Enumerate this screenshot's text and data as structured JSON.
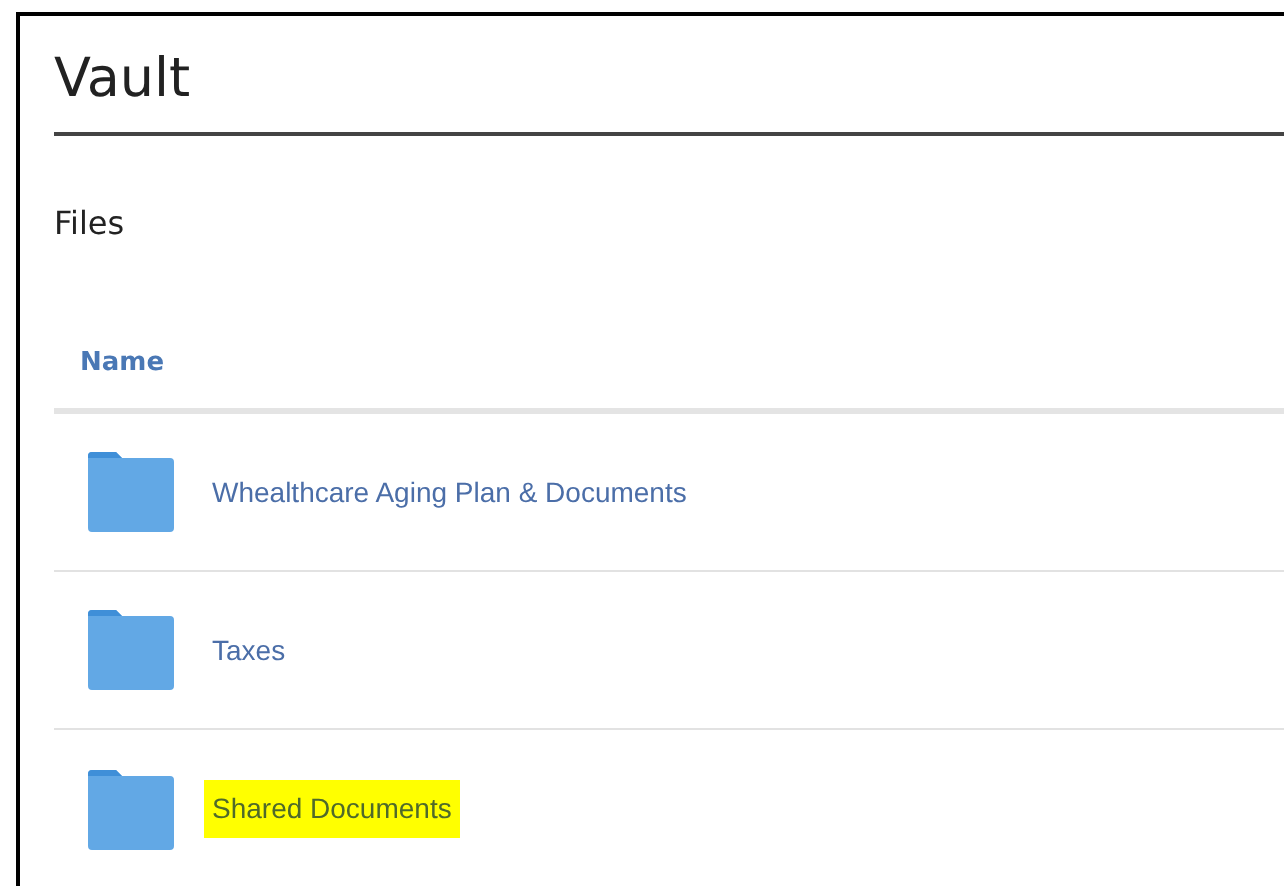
{
  "header": {
    "title": "Vault"
  },
  "section": {
    "title": "Files"
  },
  "table": {
    "columns": [
      "Name"
    ],
    "rows": [
      {
        "name": "Whealthcare Aging Plan & Documents",
        "highlighted": false
      },
      {
        "name": "Taxes",
        "highlighted": false
      },
      {
        "name": "Shared Documents",
        "highlighted": true
      }
    ]
  }
}
